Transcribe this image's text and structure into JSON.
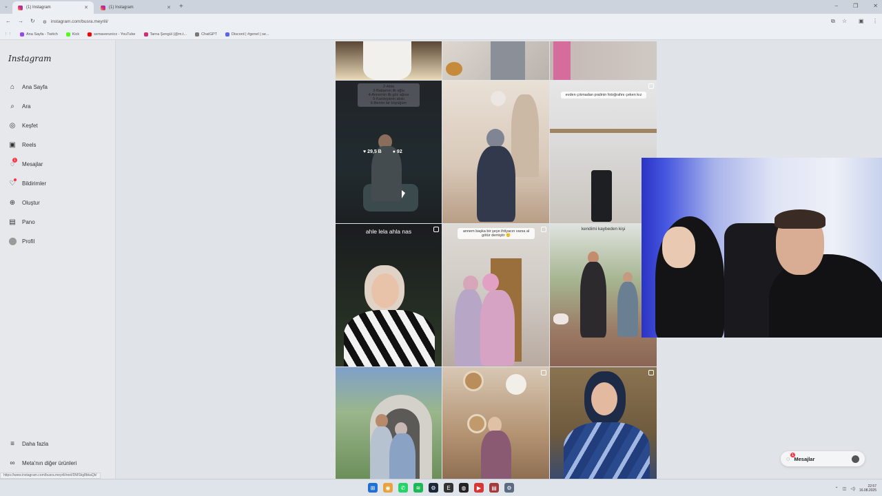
{
  "browser": {
    "tabs": [
      {
        "label": "(1) Instagram",
        "active": true
      },
      {
        "label": "(1) Instagram",
        "active": false
      }
    ],
    "url": "instagram.com/busra.meyrili/",
    "bookmarks": [
      {
        "label": "Ana Sayfa - Twitch",
        "color": "#9146ff"
      },
      {
        "label": "Kick",
        "color": "#53fc18"
      },
      {
        "label": "semaverunicx - YouTube",
        "color": "#ff0000"
      },
      {
        "label": "Tarna Şengül (@m.t...",
        "color": "#d62976"
      },
      {
        "label": "ChatGPT",
        "color": "#777777"
      },
      {
        "label": "Discord | #genel | se...",
        "color": "#5865f2"
      }
    ]
  },
  "sidebar": {
    "logo": "Instagram",
    "items": [
      {
        "label": "Ana Sayfa",
        "icon": "home-icon"
      },
      {
        "label": "Ara",
        "icon": "search-icon"
      },
      {
        "label": "Keşfet",
        "icon": "compass-icon"
      },
      {
        "label": "Reels",
        "icon": "reels-icon"
      },
      {
        "label": "Mesajlar",
        "icon": "messenger-icon",
        "badge": "1"
      },
      {
        "label": "Bildirimler",
        "icon": "heart-icon"
      },
      {
        "label": "Oluştur",
        "icon": "plus-square-icon"
      },
      {
        "label": "Pano",
        "icon": "dashboard-icon"
      },
      {
        "label": "Profil",
        "icon": "profile-avatar"
      }
    ],
    "more": "Daha fazla",
    "meta": "Meta'nın diğer ürünleri"
  },
  "grid": {
    "tile_r1c1_text": "2-Abla\n3-Babamın ilk oğlu\n4-Annemin ilk göz ağrısı\n5-Kardeşlerin abisi\n6-Benim bir büyüğüm",
    "likes": "29,5 B",
    "comments": "92",
    "tile_r1c3_text": "evden çıkmadan pralinin fotoğrafını çeken kız",
    "tile_r2c1_text": "ahle lela ahla nas",
    "tile_r2c2_text": "annem başka bir şeye ihtiyacın varsa al götür demiştir 🙂",
    "tile_r2c3_text": "kendimi kaybeden kişi"
  },
  "messages_pill": {
    "label": "Mesajlar",
    "badge": "1"
  },
  "status_url": "https://www.instagram.com/busra.meyrili/reel/DMSkg8bkaQk/",
  "taskbar": {
    "time": "22:57",
    "date": "16.08.2025"
  }
}
